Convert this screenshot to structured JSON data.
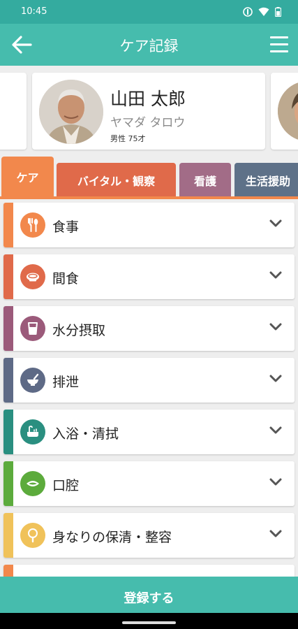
{
  "status_bar": {
    "time": "10:45"
  },
  "app_bar": {
    "title": "ケア記録"
  },
  "user": {
    "name": "山田 太郎",
    "kana": "ヤマダ タロウ",
    "meta": "男性 75才"
  },
  "tabs": [
    {
      "label": "ケア",
      "color": "#f2884c",
      "active": true
    },
    {
      "label": "バイタル・観察",
      "color": "#e06a4a",
      "active": false
    },
    {
      "label": "看護",
      "color": "#a26c87",
      "active": false
    },
    {
      "label": "生活援助",
      "color": "#5e7188",
      "active": false
    }
  ],
  "care_items": [
    {
      "label": "食事",
      "color": "#f2884c",
      "icon": "fork-spoon-icon"
    },
    {
      "label": "間食",
      "color": "#e06a4a",
      "icon": "snack-bowl-icon"
    },
    {
      "label": "水分摂取",
      "color": "#9b5a7a",
      "icon": "cup-icon"
    },
    {
      "label": "排泄",
      "color": "#5e6a86",
      "icon": "toilet-icon"
    },
    {
      "label": "入浴・清拭",
      "color": "#2a8f80",
      "icon": "bath-icon"
    },
    {
      "label": "口腔",
      "color": "#5cab3c",
      "icon": "mouth-icon"
    },
    {
      "label": "身なりの保清・整容",
      "color": "#f0c25a",
      "icon": "mirror-icon"
    },
    {
      "label": "",
      "color": "#f2884c",
      "icon": ""
    }
  ],
  "footer": {
    "register_label": "登録する"
  }
}
